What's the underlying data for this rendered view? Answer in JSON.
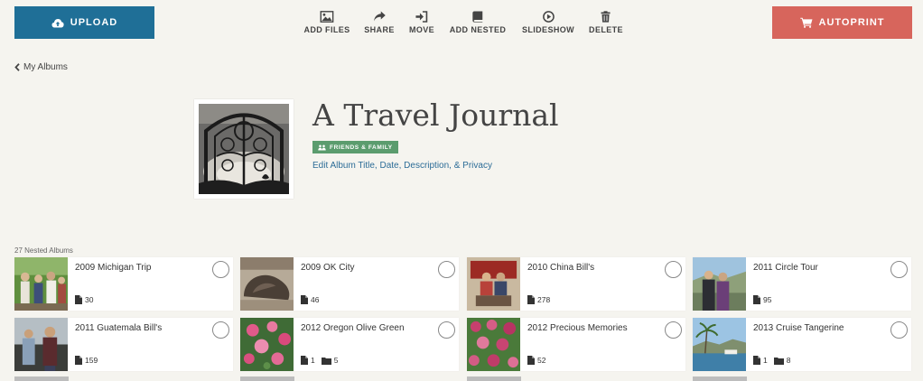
{
  "toolbar": {
    "upload_label": "UPLOAD",
    "autoprint_label": "AUTOPRINT",
    "tools": [
      {
        "label": "ADD FILES",
        "icon": "image-icon"
      },
      {
        "label": "SHARE",
        "icon": "share-arrow-icon"
      },
      {
        "label": "MOVE",
        "icon": "move-in-icon"
      },
      {
        "label": "ADD NESTED",
        "icon": "book-icon"
      },
      {
        "label": "SLIDESHOW",
        "icon": "play-circle-icon"
      },
      {
        "label": "DELETE",
        "icon": "trash-icon"
      }
    ],
    "upload_color": "#1f6f97",
    "autoprint_color": "#d7655c"
  },
  "breadcrumb": {
    "back_label": "My Albums"
  },
  "album": {
    "title": "A Travel Journal",
    "privacy": "FRIENDS & FAMILY",
    "privacy_color": "#5b9c6e",
    "edit_link": "Edit Album Title, Date, Description, & Privacy"
  },
  "nested": {
    "count_label": "27 Nested Albums",
    "albums": [
      {
        "name": "2009 Michigan Trip",
        "files": "30",
        "folders": ""
      },
      {
        "name": "2009 OK City",
        "files": "46",
        "folders": ""
      },
      {
        "name": "2010 China Bill's",
        "files": "278",
        "folders": ""
      },
      {
        "name": "2011 Circle Tour",
        "files": "95",
        "folders": ""
      },
      {
        "name": "2011 Guatemala Bill's",
        "files": "159",
        "folders": ""
      },
      {
        "name": "2012 Oregon Olive Green",
        "files": "1",
        "folders": "5"
      },
      {
        "name": "2012 Precious Memories",
        "files": "52",
        "folders": ""
      },
      {
        "name": "2013 Cruise Tangerine",
        "files": "1",
        "folders": "8"
      }
    ]
  }
}
